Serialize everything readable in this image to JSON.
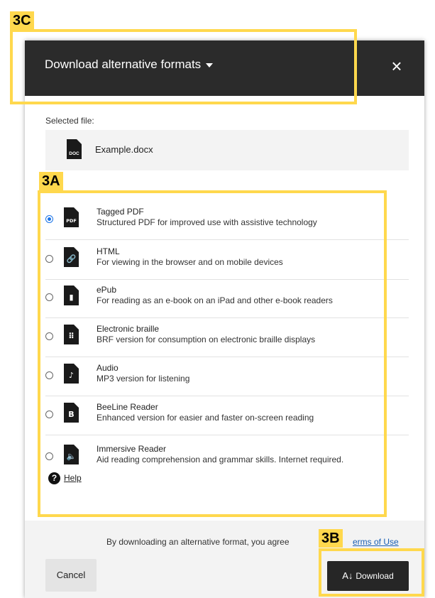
{
  "dialog": {
    "title": "Download alternative formats",
    "close": "×"
  },
  "file": {
    "label": "Selected file:",
    "name": "Example.docx",
    "icon": "doc-file-icon",
    "icon_text": "DOC"
  },
  "formats": [
    {
      "name": "Tagged PDF",
      "desc": "Structured PDF for improved use with assistive technology",
      "selected": true,
      "icon": "pdf-file-icon",
      "glyph": "PDF"
    },
    {
      "name": "HTML",
      "desc": "For viewing in the browser and on mobile devices",
      "selected": false,
      "icon": "link-file-icon",
      "glyph": "🔗"
    },
    {
      "name": "ePub",
      "desc": "For reading as an e-book on an iPad and other e-book readers",
      "selected": false,
      "icon": "book-file-icon",
      "glyph": "▮"
    },
    {
      "name": "Electronic braille",
      "desc": "BRF version for consumption on electronic braille displays",
      "selected": false,
      "icon": "braille-file-icon",
      "glyph": "⠿"
    },
    {
      "name": "Audio",
      "desc": "MP3 version for listening",
      "selected": false,
      "icon": "audio-file-icon",
      "glyph": "♪"
    },
    {
      "name": "BeeLine Reader",
      "desc": "Enhanced version for easier and faster on-screen reading",
      "selected": false,
      "icon": "beeline-file-icon",
      "glyph": "B"
    },
    {
      "name": "Immersive Reader",
      "desc": "Aid reading comprehension and grammar skills. Internet required.",
      "selected": false,
      "icon": "speaker-file-icon",
      "glyph": "🔈"
    }
  ],
  "help": {
    "icon": "?",
    "label": "Help"
  },
  "footer": {
    "agree": "By downloading an alternative format, you agree",
    "terms": "erms of Use",
    "cancel": "Cancel",
    "download": "Download",
    "download_icon": "A↓"
  },
  "annotations": {
    "a": "3A",
    "b": "3B",
    "c": "3C",
    "color": "#ffd84d"
  }
}
